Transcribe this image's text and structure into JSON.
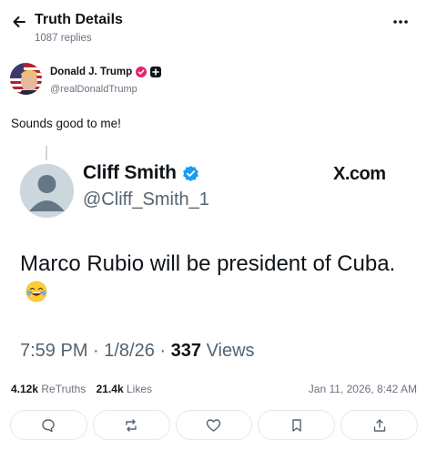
{
  "header": {
    "title": "Truth Details",
    "subtitle": "1087 replies"
  },
  "author": {
    "name": "Donald J. Trump",
    "handle": "@realDonaldTrump"
  },
  "post": {
    "text": "Sounds good to me!"
  },
  "quote": {
    "name": "Cliff Smith",
    "handle": "@Cliff_Smith_1",
    "source": "X.com",
    "text": "Marco Rubio will be president of Cuba.",
    "time": "7:59 PM · 1/8/26 · ",
    "views_count": "337",
    "views_label": " Views"
  },
  "stats": {
    "retruths_count": "4.12k",
    "retruths_label": "ReTruths",
    "likes_count": "21.4k",
    "likes_label": "Likes",
    "timestamp": "Jan 11, 2026, 8:42 AM"
  },
  "colors": {
    "verified_badge_author": "#e5226d",
    "verified_badge_quote": "#1d9bf0",
    "text_primary": "#0f1419",
    "text_secondary": "#6b7280"
  },
  "icons": {
    "back": "arrow-left-icon",
    "more": "more-horizontal-icon",
    "reply": "comment-icon",
    "retruth": "repost-icon",
    "like": "heart-icon",
    "bookmark": "bookmark-icon",
    "share": "share-icon"
  }
}
